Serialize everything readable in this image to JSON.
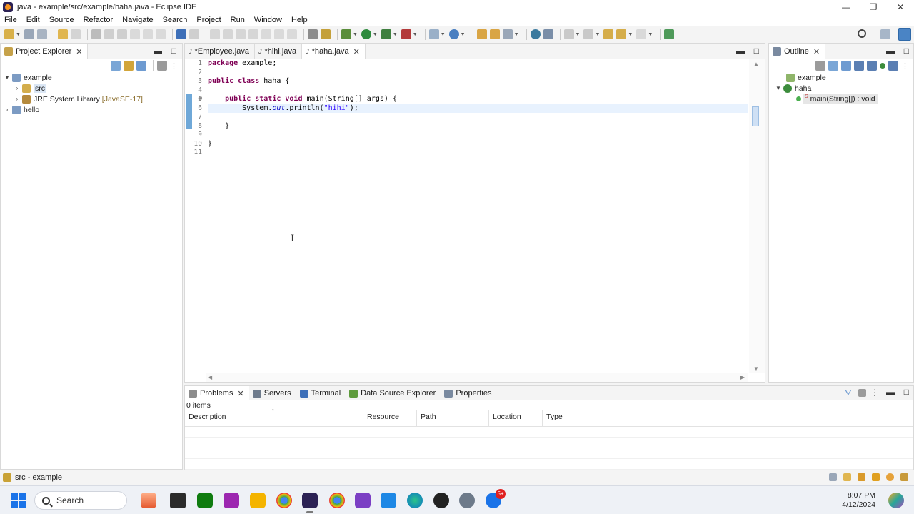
{
  "window": {
    "title": "java - example/src/example/haha.java - Eclipse IDE",
    "minimize": "—",
    "maximize": "❐",
    "close": "✕"
  },
  "menu": [
    "File",
    "Edit",
    "Source",
    "Refactor",
    "Navigate",
    "Search",
    "Project",
    "Run",
    "Window",
    "Help"
  ],
  "project_explorer": {
    "title": "Project Explorer",
    "tree": [
      {
        "label": "example",
        "expanded": true
      },
      {
        "label": "src",
        "selected": true
      },
      {
        "label": "JRE System Library",
        "tag": "[JavaSE-17]"
      },
      {
        "label": "hello",
        "expanded": false
      }
    ]
  },
  "editor": {
    "tabs": [
      {
        "label": "*Employee.java",
        "active": false
      },
      {
        "label": "*hihi.java",
        "active": false
      },
      {
        "label": "*haha.java",
        "active": true
      }
    ],
    "tab_icon": "J",
    "line_numbers": [
      "1",
      "2",
      "3",
      "4",
      "5",
      "6",
      "7",
      "8",
      "9",
      "10",
      "11"
    ],
    "current_line": 6,
    "code": {
      "l1_kw": "package",
      "l1_rest": " example;",
      "l3_kw1": "public",
      "l3_kw2": " class",
      "l3_rest": " haha {",
      "l5_indent": "    ",
      "l5_kw1": "public",
      "l5_kw2": " static",
      "l5_kw3": " void",
      "l5_rest": " main(String[] args) {",
      "l6_indent": "        System.",
      "l6_field": "out",
      "l6_mid": ".println(",
      "l6_str": "\"hihi\"",
      "l6_end": ");",
      "l8": "    }",
      "l10": "}"
    },
    "caret": "I"
  },
  "outline": {
    "title": "Outline",
    "package": "example",
    "class": "haha",
    "method": "main(String[]) : void",
    "method_mod": "S"
  },
  "bottom_panel": {
    "tabs": [
      "Problems",
      "Servers",
      "Terminal",
      "Data Source Explorer",
      "Properties"
    ],
    "items_count": "0 items",
    "columns": [
      "Description",
      "Resource",
      "Path",
      "Location",
      "Type"
    ]
  },
  "status_bar": {
    "text": "src - example"
  },
  "taskbar": {
    "search_label": "Search",
    "time": "8:07 PM",
    "date": "4/12/2024",
    "chat_badge": "5+"
  },
  "colors": {
    "keyword": "#7f0055",
    "string": "#2a00ff",
    "field": "#0000c0",
    "selection": "#dbe7f5",
    "current_line": "#e8f2fe"
  }
}
